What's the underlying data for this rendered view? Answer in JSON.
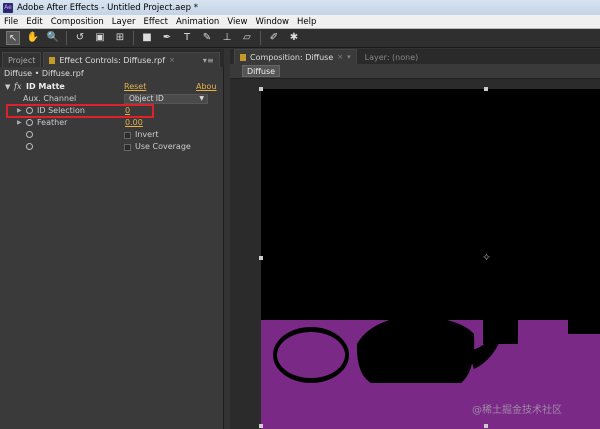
{
  "window": {
    "title": "Adobe After Effects - Untitled Project.aep *",
    "app_icon": "Ae"
  },
  "menu": [
    "File",
    "Edit",
    "Composition",
    "Layer",
    "Effect",
    "Animation",
    "View",
    "Window",
    "Help"
  ],
  "toolbar": {
    "tools": [
      {
        "name": "selection-tool-icon",
        "glyph": "↖",
        "selected": true
      },
      {
        "name": "hand-tool-icon",
        "glyph": "✋"
      },
      {
        "name": "zoom-tool-icon",
        "glyph": "🔍"
      },
      {
        "name": "rotate-tool-icon",
        "glyph": "↺"
      },
      {
        "name": "camera-tool-icon",
        "glyph": "▣"
      },
      {
        "name": "pan-behind-tool-icon",
        "glyph": "⊞"
      },
      {
        "name": "rectangle-tool-icon",
        "glyph": "■"
      },
      {
        "name": "pen-tool-icon",
        "glyph": "✒"
      },
      {
        "name": "type-tool-icon",
        "glyph": "T"
      },
      {
        "name": "brush-tool-icon",
        "glyph": "✎"
      },
      {
        "name": "clone-stamp-tool-icon",
        "glyph": "⊥"
      },
      {
        "name": "eraser-tool-icon",
        "glyph": "▱"
      },
      {
        "name": "roto-brush-tool-icon",
        "glyph": "✐"
      },
      {
        "name": "puppet-pin-tool-icon",
        "glyph": "✱"
      }
    ]
  },
  "left_panel": {
    "tabs": {
      "project": "Project",
      "effect_controls": "Effect Controls: Diffuse.rpf"
    },
    "breadcrumb": "Diffuse • Diffuse.rpf",
    "effect": {
      "fx": "fx",
      "name": "ID Matte",
      "reset": "Reset",
      "about": "Abou",
      "aux_channel_label": "Aux. Channel",
      "aux_channel_value": "Object ID",
      "id_selection_label": "ID Selection",
      "id_selection_value": "0",
      "feather_label": "Feather",
      "feather_value": "0.00",
      "invert_label": "Invert",
      "coverage_label": "Use Coverage"
    }
  },
  "right_panel": {
    "comp_tab": "Composition: Diffuse",
    "layer_tab": "Layer: (none)",
    "subtab": "Diffuse"
  },
  "colors": {
    "accent_value": "#e8b04a",
    "highlight_box": "#e0202a",
    "floor_purple": "#7a2a86"
  },
  "watermark": "@稀土掘金技术社区"
}
